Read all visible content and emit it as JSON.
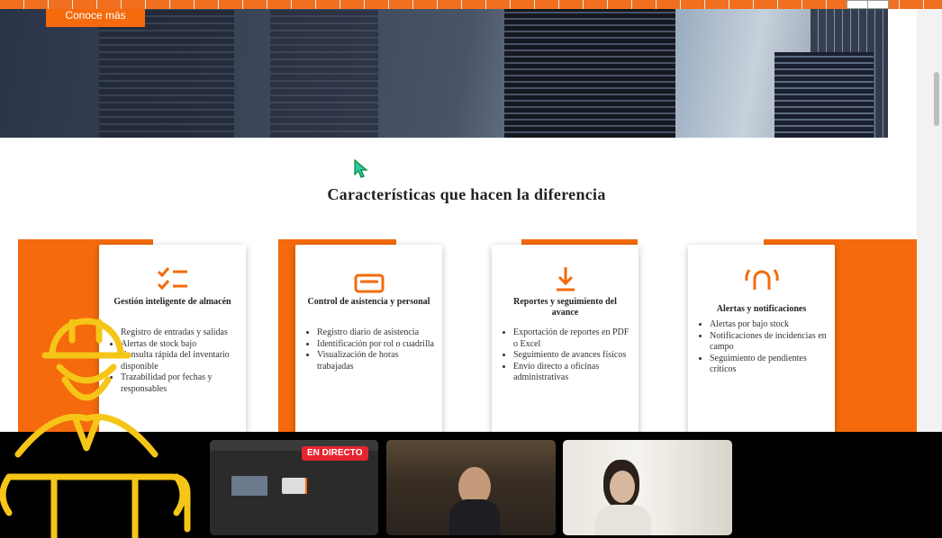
{
  "hero": {
    "button_label": "Conoce más"
  },
  "section": {
    "title": "Características que hacen la diferencia"
  },
  "cards": [
    {
      "title": "Gestión inteligente de almacén",
      "icon": "checklist-icon",
      "items": [
        "Registro de entradas y salidas",
        "Alertas de stock bajo",
        "Consulta rápida del inventario disponible",
        "Trazabilidad por fechas y responsables"
      ]
    },
    {
      "title": "Control de asistencia y personal",
      "icon": "id-card-icon",
      "items": [
        "Registro diario de asistencia",
        "Identificación por rol o cuadrilla",
        "Visualización de horas trabajadas"
      ]
    },
    {
      "title": "Reportes y seguimiento del avance",
      "icon": "download-icon",
      "items": [
        "Exportación de reportes en PDF o Excel",
        "Seguimiento de avances físicos",
        "Envío directo a oficinas administrativas"
      ]
    },
    {
      "title": "Alertas y notificaciones",
      "icon": "alarm-icon",
      "items": [
        "Alertas por bajo stock",
        "Notificaciones de incidencias en campo",
        "Seguimiento de pendientes críticos"
      ]
    }
  ],
  "meeting": {
    "live_label": "EN DIRECTO"
  },
  "colors": {
    "accent": "#f46a0c",
    "live": "#e5252f",
    "mascot": "#f5c518"
  }
}
